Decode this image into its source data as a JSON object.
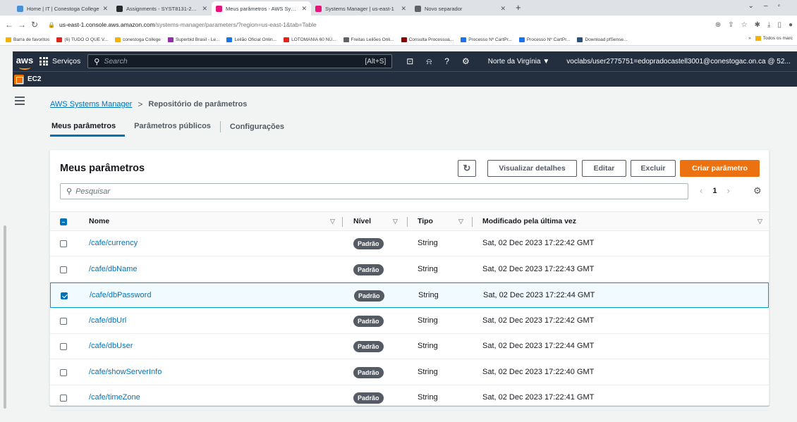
{
  "browser": {
    "tabs": [
      {
        "title": "Home | IT | Conestoga College",
        "color": "#4a90d9"
      },
      {
        "title": "Assignments - SYST8131-23F-Se",
        "color": "#2b2b2b"
      },
      {
        "title": "Meus parâmetros - AWS System",
        "color": "#e7157b",
        "active": true
      },
      {
        "title": "Systems Manager | us-east-1",
        "color": "#e7157b"
      },
      {
        "title": "Novo separador",
        "color": "#5f6368"
      }
    ],
    "url_host": "us-east-1.console.aws.amazon.com",
    "url_path": "/systems-manager/parameters/?region=us-east-1&tab=Table",
    "bookmarks": [
      {
        "label": "Barra de favoritos",
        "color": "#f4b400"
      },
      {
        "label": "(6) TUDO O QUE V...",
        "color": "#e62117"
      },
      {
        "label": "conestoga College",
        "color": "#f4b400"
      },
      {
        "label": "Superbid Brasil - Le...",
        "color": "#9c27b0"
      },
      {
        "label": "Leilão Oficial Onlin...",
        "color": "#1a73e8"
      },
      {
        "label": "LOTOMANIA 60 NÚ...",
        "color": "#e62117"
      },
      {
        "label": "Freitas Leilões Onli...",
        "color": "#5f6368"
      },
      {
        "label": "Consulta Processua...",
        "color": "#8b0000"
      },
      {
        "label": "Processo Nº CartPr...",
        "color": "#1a73e8"
      },
      {
        "label": "Processo Nº CartPr...",
        "color": "#1a73e8"
      },
      {
        "label": "Download pfSense...",
        "color": "#2b4f81"
      }
    ],
    "bookmarks_more": "»",
    "bookmarks_all": "Todos os marc"
  },
  "aws": {
    "logo": "aws",
    "services_label": "Serviços",
    "search_placeholder": "Search",
    "search_shortcut": "[Alt+S]",
    "region": "Norte da Virgínia ▼",
    "account": "voclabs/user2775751=edopradocastell3001@conestogac.on.ca @ 52...",
    "service_name": "EC2"
  },
  "breadcrumb": {
    "root": "AWS Systems Manager",
    "separator": ">",
    "current": "Repositório de parâmetros"
  },
  "page_tabs": [
    "Meus parâmetros",
    "Parâmetros públicos",
    "Configurações"
  ],
  "panel": {
    "title": "Meus parâmetros",
    "buttons": {
      "view": "Visualizar detalhes",
      "edit": "Editar",
      "delete": "Excluir",
      "create": "Criar parâmetro"
    },
    "search_placeholder": "Pesquisar",
    "page_number": "1",
    "columns": {
      "name": "Nome",
      "level": "Nível",
      "type": "Tipo",
      "modified": "Modificado pela última vez"
    },
    "rows": [
      {
        "name": "/cafe/currency",
        "level": "Padrão",
        "type": "String",
        "modified": "Sat, 02 Dec 2023 17:22:42 GMT",
        "checked": false
      },
      {
        "name": "/cafe/dbName",
        "level": "Padrão",
        "type": "String",
        "modified": "Sat, 02 Dec 2023 17:22:43 GMT",
        "checked": false
      },
      {
        "name": "/cafe/dbPassword",
        "level": "Padrão",
        "type": "String",
        "modified": "Sat, 02 Dec 2023 17:22:44 GMT",
        "checked": true
      },
      {
        "name": "/cafe/dbUrl",
        "level": "Padrão",
        "type": "String",
        "modified": "Sat, 02 Dec 2023 17:22:42 GMT",
        "checked": false
      },
      {
        "name": "/cafe/dbUser",
        "level": "Padrão",
        "type": "String",
        "modified": "Sat, 02 Dec 2023 17:22:44 GMT",
        "checked": false
      },
      {
        "name": "/cafe/showServerInfo",
        "level": "Padrão",
        "type": "String",
        "modified": "Sat, 02 Dec 2023 17:22:40 GMT",
        "checked": false
      },
      {
        "name": "/cafe/timeZone",
        "level": "Padrão",
        "type": "String",
        "modified": "Sat, 02 Dec 2023 17:22:41 GMT",
        "checked": false
      }
    ]
  }
}
